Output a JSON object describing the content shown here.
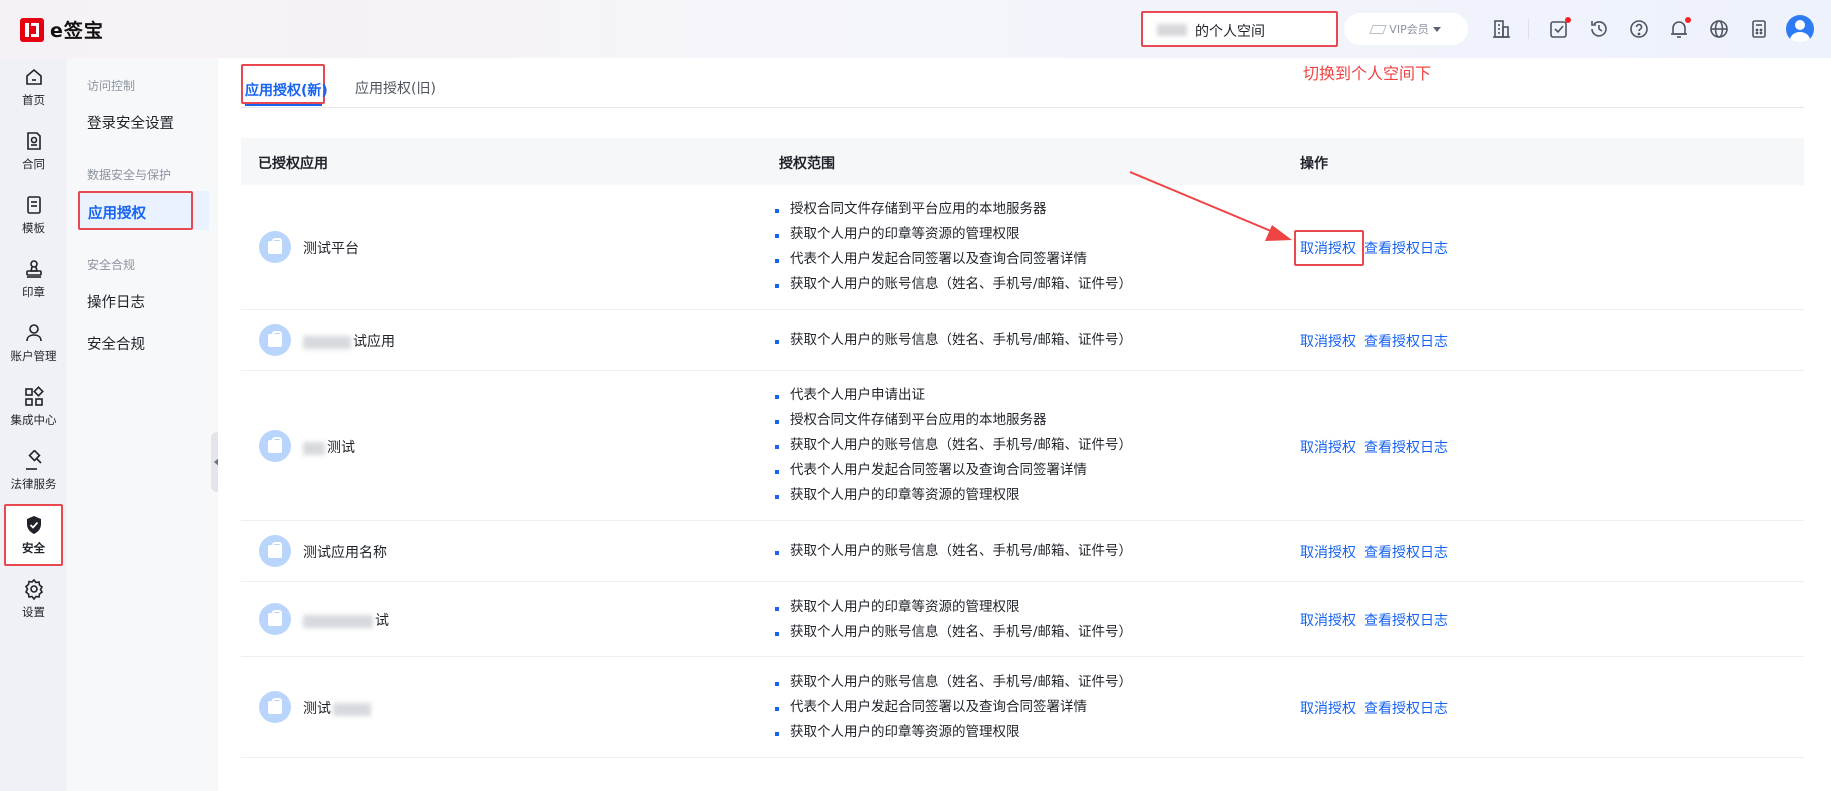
{
  "brand": {
    "name": "e签宝"
  },
  "header": {
    "space_label": "的个人空间",
    "vip_label": "VIP会员"
  },
  "icons": [
    "building-icon",
    "task-icon",
    "history-icon",
    "help-icon",
    "bell-icon",
    "globe-icon",
    "calculator-icon",
    "avatar"
  ],
  "leftnav": [
    {
      "label": "首页",
      "icon": "home-icon"
    },
    {
      "label": "合同",
      "icon": "contract-icon"
    },
    {
      "label": "模板",
      "icon": "template-icon"
    },
    {
      "label": "印章",
      "icon": "seal-icon"
    },
    {
      "label": "账户管理",
      "icon": "account-icon"
    },
    {
      "label": "集成中心",
      "icon": "integration-icon"
    },
    {
      "label": "法律服务",
      "icon": "legal-icon"
    },
    {
      "label": "安全",
      "icon": "shield-icon"
    },
    {
      "label": "设置",
      "icon": "settings-icon"
    }
  ],
  "subnav": {
    "group1": "访问控制",
    "item_login": "登录安全设置",
    "group2": "数据安全与保护",
    "item_app_auth": "应用授权",
    "group3": "安全合规",
    "item_log": "操作日志",
    "item_compliance": "安全合规"
  },
  "tabs": {
    "new": "应用授权(新)",
    "old": "应用授权(旧)"
  },
  "annotation": {
    "hint": "切换到个人空间下"
  },
  "table": {
    "headers": {
      "app": "已授权应用",
      "scope": "授权范围",
      "ops": "操作"
    },
    "revoke_label": "取消授权",
    "log_label": "查看授权日志",
    "rows": [
      {
        "name": "测试平台",
        "scopes": [
          "授权合同文件存储到平台应用的本地服务器",
          "获取个人用户的印章等资源的管理权限",
          "代表个人用户发起合同签署以及查询合同签署详情",
          "获取个人用户的账号信息（姓名、手机号/邮箱、证件号）"
        ]
      },
      {
        "name": "试应用",
        "scopes": [
          "获取个人用户的账号信息（姓名、手机号/邮箱、证件号）"
        ]
      },
      {
        "name": "测试",
        "scopes": [
          "代表个人用户申请出证",
          "授权合同文件存储到平台应用的本地服务器",
          "获取个人用户的账号信息（姓名、手机号/邮箱、证件号）",
          "代表个人用户发起合同签署以及查询合同签署详情",
          "获取个人用户的印章等资源的管理权限"
        ]
      },
      {
        "name": "测试应用名称",
        "scopes": [
          "获取个人用户的账号信息（姓名、手机号/邮箱、证件号）"
        ]
      },
      {
        "name": "试",
        "scopes": [
          "获取个人用户的印章等资源的管理权限",
          "获取个人用户的账号信息（姓名、手机号/邮箱、证件号）"
        ]
      },
      {
        "name": "测试",
        "scopes": [
          "获取个人用户的账号信息（姓名、手机号/邮箱、证件号）",
          "代表个人用户发起合同签署以及查询合同签署详情",
          "获取个人用户的印章等资源的管理权限"
        ]
      }
    ]
  }
}
